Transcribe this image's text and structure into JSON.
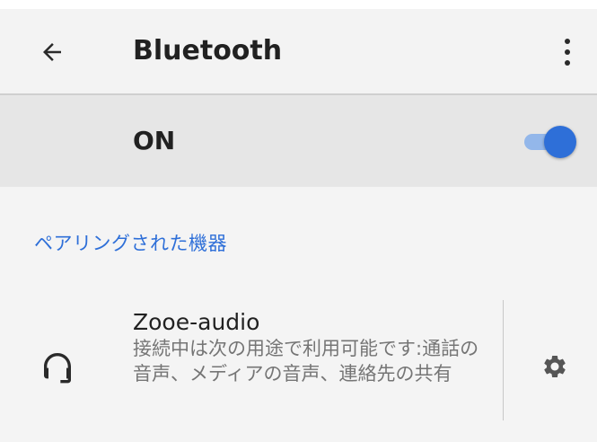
{
  "app_bar": {
    "title": "Bluetooth",
    "back_icon": "arrow-left-icon",
    "more_icon": "more-vertical-icon"
  },
  "toggle": {
    "label": "ON",
    "state": true
  },
  "paired_section": {
    "header": "ペアリングされた機器"
  },
  "device": {
    "name": "Zooe-audio",
    "status": "接続中は次の用途で利用可能です:通話の音声、メディアの音声、連絡先の共有",
    "icon": "headset-icon",
    "settings_icon": "gear-icon"
  },
  "colors": {
    "accent": "#2e6fd8",
    "switch_track": "#93b7ea",
    "background": "#f4f4f4",
    "toggle_row_bg": "#e6e6e6"
  }
}
